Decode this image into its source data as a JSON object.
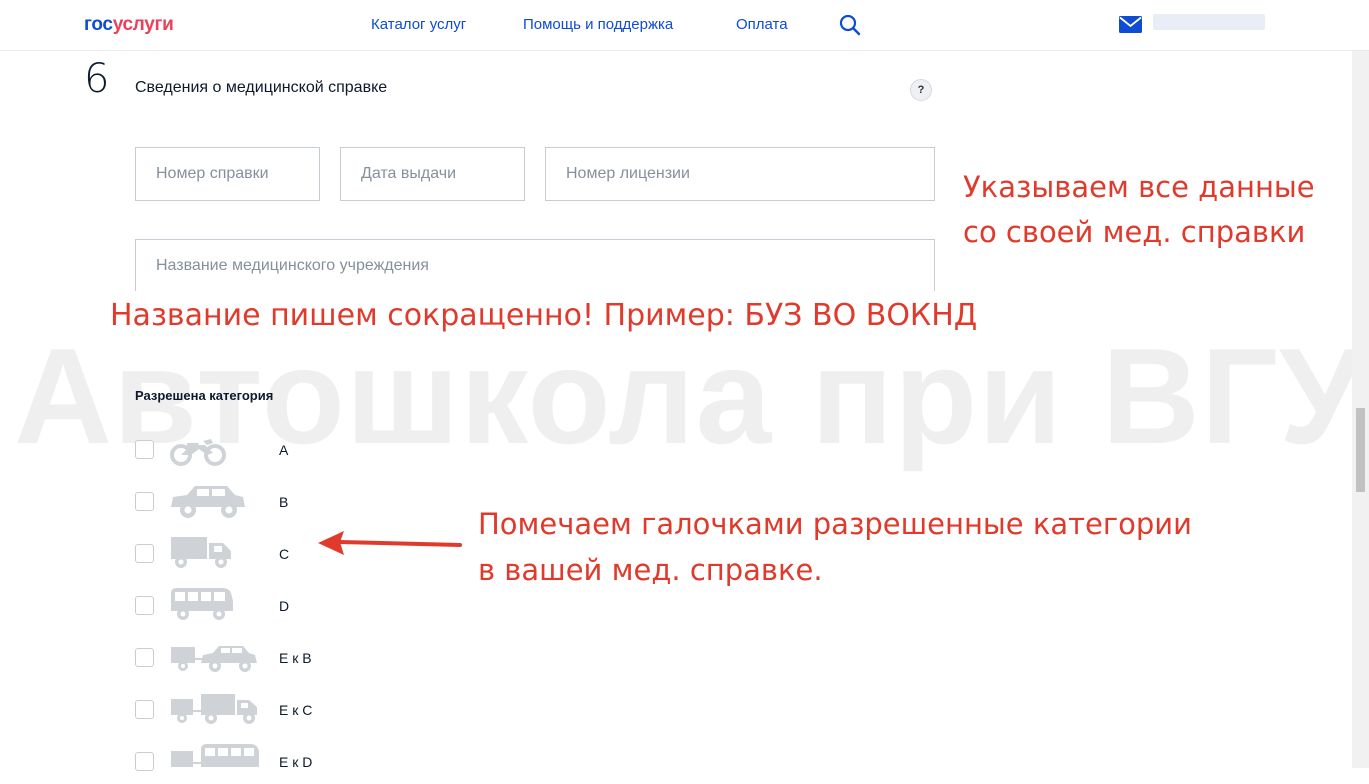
{
  "header": {
    "logo_part1": "гос",
    "logo_part2": "услуги",
    "nav": [
      "Каталог услуг",
      "Помощь и поддержка",
      "Оплата"
    ],
    "icons": [
      "search-icon",
      "mail-icon"
    ]
  },
  "section": {
    "number": "6",
    "title": "Сведения о медицинской справке",
    "help_label": "?"
  },
  "fields": {
    "certificate_number": {
      "placeholder": "Номер справки",
      "value": ""
    },
    "issue_date": {
      "placeholder": "Дата выдачи",
      "value": ""
    },
    "license_number": {
      "placeholder": "Номер лицензии",
      "value": ""
    },
    "institution_name": {
      "placeholder": "Название медицинского учреждения",
      "value": ""
    }
  },
  "annotations": {
    "fill_data_line1": "Указываем все данные",
    "fill_data_line2": "со своей мед. справки",
    "name_hint": "Название пишем сокращенно! Пример: БУЗ ВО ВОКНД",
    "categories_line1": "Помечаем галочками разрешенные категории",
    "categories_line2": "в вашей мед. справке."
  },
  "watermark": "Автошкола при ВГУ",
  "categories": {
    "title": "Разрешена категория",
    "items": [
      {
        "label": "A",
        "icon": "motorcycle-icon",
        "checked": false
      },
      {
        "label": "B",
        "icon": "car-icon",
        "checked": false
      },
      {
        "label": "C",
        "icon": "truck-icon",
        "checked": false
      },
      {
        "label": "D",
        "icon": "bus-icon",
        "checked": false
      },
      {
        "label": "E к B",
        "icon": "car-trailer-icon",
        "checked": false
      },
      {
        "label": "E к C",
        "icon": "truck-trailer-icon",
        "checked": false
      },
      {
        "label": "E к D",
        "icon": "bus-trailer-icon",
        "checked": false
      }
    ]
  },
  "colors": {
    "brand_blue": "#0d4cd3",
    "brand_red": "#ee3f58",
    "annotation_red": "#e03a2c"
  }
}
